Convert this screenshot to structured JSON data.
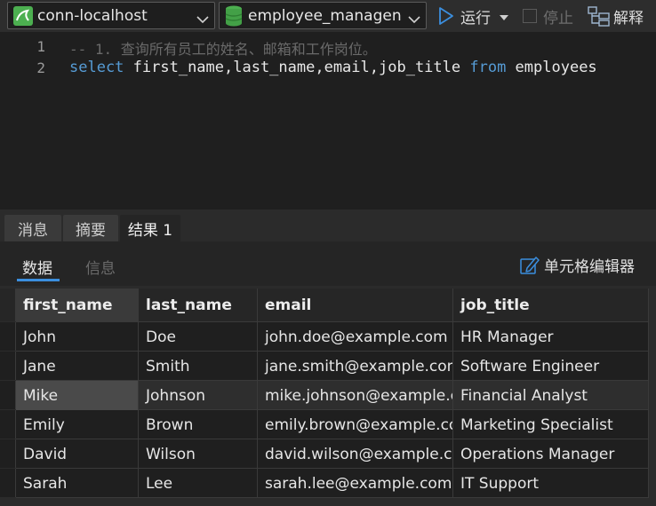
{
  "toolbar": {
    "connection": "conn-localhost",
    "database": "employee_managen",
    "run_label": "运行",
    "stop_label": "停止",
    "explain_label": "解释",
    "accent_run": "#3b8ede"
  },
  "editor": {
    "line_numbers": [
      "1",
      "2"
    ],
    "line1_comment": "-- 1. 查询所有员工的姓名、邮箱和工作岗位。",
    "line2": {
      "kw_select": "select",
      "cols": " first_name,last_name,email,job_title ",
      "kw_from": "from",
      "table": " employees"
    }
  },
  "result_tabs": [
    {
      "label": "消息"
    },
    {
      "label": "摘要"
    },
    {
      "label": "结果 1"
    }
  ],
  "sub_tabs": [
    {
      "label": "数据"
    },
    {
      "label": "信息"
    }
  ],
  "cell_editor_label": "单元格编辑器",
  "table": {
    "columns": [
      "first_name",
      "last_name",
      "email",
      "job_title"
    ],
    "rows": [
      [
        "John",
        "Doe",
        "john.doe@example.com",
        "HR Manager"
      ],
      [
        "Jane",
        "Smith",
        "jane.smith@example.com",
        "Software Engineer"
      ],
      [
        "Mike",
        "Johnson",
        "mike.johnson@example.com",
        "Financial Analyst"
      ],
      [
        "Emily",
        "Brown",
        "emily.brown@example.com",
        "Marketing Specialist"
      ],
      [
        "David",
        "Wilson",
        "david.wilson@example.com",
        "Operations Manager"
      ],
      [
        "Sarah",
        "Lee",
        "sarah.lee@example.com",
        "IT Support"
      ]
    ]
  }
}
